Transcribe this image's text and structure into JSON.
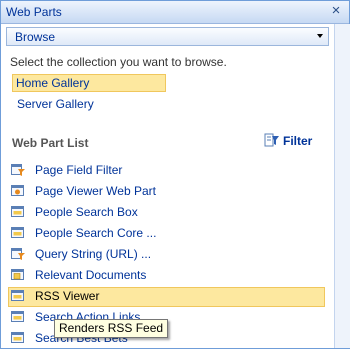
{
  "window": {
    "title": "Web Parts"
  },
  "browse_dropdown": {
    "selected": "Browse"
  },
  "instruction": "Select the collection you want to browse.",
  "galleries": [
    {
      "label": "Home Gallery",
      "selected": true
    },
    {
      "label": "Server Gallery",
      "selected": false
    }
  ],
  "web_part_list": {
    "title": "Web Part List",
    "filter_label": "Filter",
    "items": [
      {
        "label": "Page Field Filter",
        "icon": "filter-webpart-icon"
      },
      {
        "label": "Page Viewer Web Part",
        "icon": "page-viewer-icon"
      },
      {
        "label": "People Search Box",
        "icon": "webpart-icon"
      },
      {
        "label": "People Search Core ...",
        "icon": "webpart-icon"
      },
      {
        "label": "Query String (URL) ...",
        "icon": "filter-webpart-icon"
      },
      {
        "label": "Relevant Documents",
        "icon": "documents-icon"
      },
      {
        "label": "RSS Viewer",
        "icon": "webpart-icon",
        "selected": true
      },
      {
        "label": "Search Action Links",
        "icon": "webpart-icon"
      },
      {
        "label": "Search Best Bets",
        "icon": "webpart-icon"
      }
    ]
  },
  "tooltip": "Renders RSS Feed"
}
